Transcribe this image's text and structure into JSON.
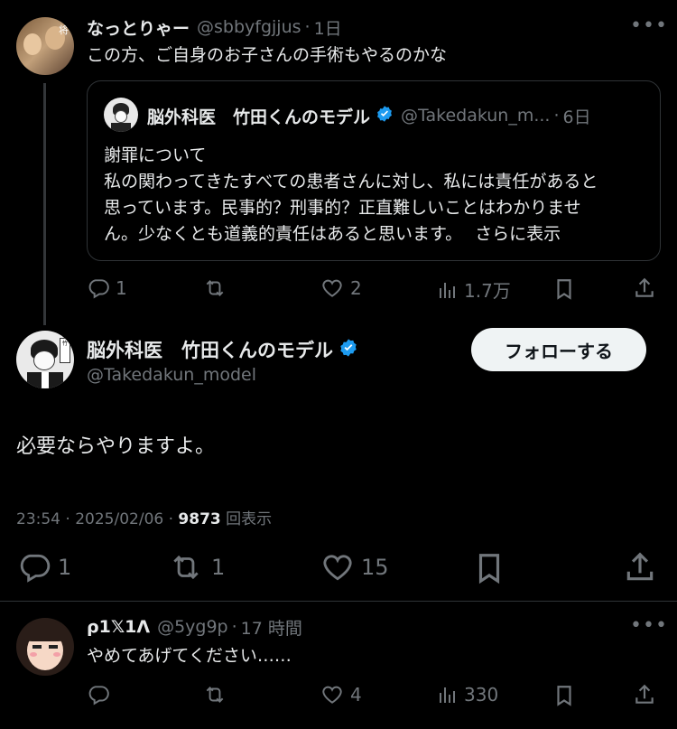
{
  "reply_top": {
    "name": "なっとりゃー",
    "handle": "@sbbyfgjjus",
    "time": "1日",
    "text": "この方、ご自身のお子さんの手術もやるのかな",
    "avatar_text": "将"
  },
  "quote": {
    "name": "脳外科医　竹田くんのモデル",
    "handle": "@Takedakun_m...",
    "time": "6日",
    "lines": [
      "謝罪について",
      "私の関わってきたすべての患者さんに対し、私には責任があると",
      "思っています。民事的？刑事的？正直難しいことはわかりませ",
      "ん。少なくとも道義的責任はあると思います。"
    ],
    "show_more": "さらに表示"
  },
  "reply_top_actions": {
    "replies": "1",
    "retweets": "",
    "likes": "2",
    "views": "1.7万"
  },
  "main": {
    "name": "脳外科医　竹田くんのモデル",
    "handle": "@Takedakun_model",
    "follow_label": "フォローする",
    "text": "必要ならやりますよ。",
    "time": "23:54",
    "date": "2025/02/06",
    "views_count": "9873",
    "views_label": "回表示",
    "replies": "1",
    "retweets": "1",
    "likes": "15"
  },
  "reply_bottom": {
    "name": "ρ1𝕏1Λ",
    "handle": "@5yg9p",
    "time": "17 時間",
    "text": "やめてあげてください……",
    "likes": "4",
    "views": "330"
  },
  "colors": {
    "background": "#000000",
    "text": "#e7e9ea",
    "muted": "#71767b",
    "verified": "#1d9bf0",
    "divider": "#2f3336"
  }
}
